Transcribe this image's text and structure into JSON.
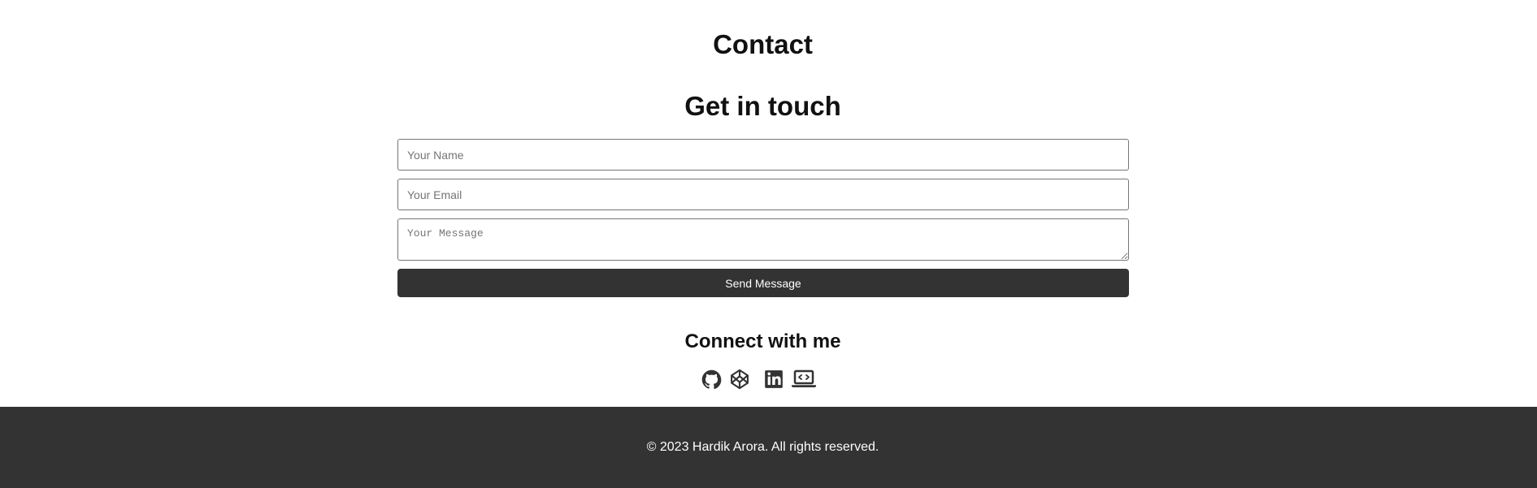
{
  "contact_section": {
    "title": "Contact",
    "subtitle": "Get in touch"
  },
  "form": {
    "name_placeholder": "Your Name",
    "email_placeholder": "Your Email",
    "message_placeholder": "Your Message",
    "name_value": "",
    "email_value": "",
    "message_value": "",
    "submit_label": "Send Message"
  },
  "connect": {
    "title": "Connect with me",
    "icons": [
      "github-icon",
      "codepen-icon",
      "linkedin-icon",
      "laptop-code-icon"
    ]
  },
  "footer": {
    "copyright": "© 2023 Hardik Arora. All rights reserved."
  },
  "colors": {
    "background": "#ffffff",
    "footer_background": "#333333",
    "button_background": "#333333",
    "text": "#111111",
    "icon": "#333333",
    "footer_text": "#ffffff"
  }
}
